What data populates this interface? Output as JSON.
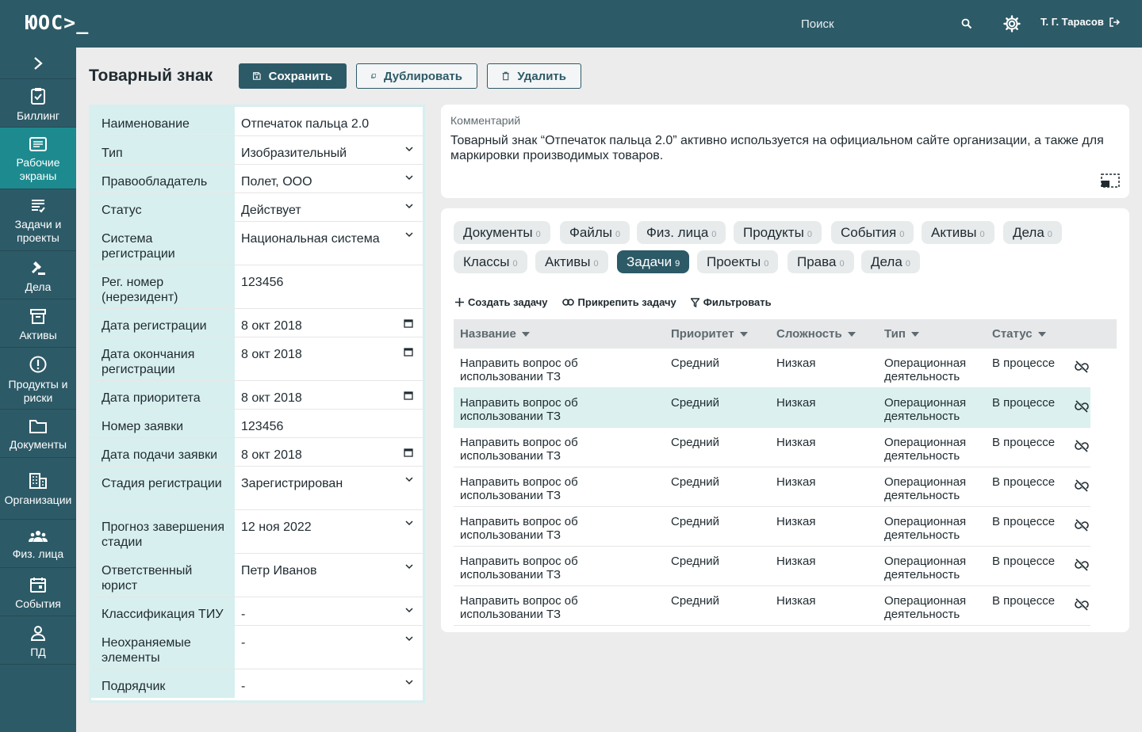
{
  "topbar": {
    "logo": "ЮОС>_",
    "search_placeholder": "Поиск",
    "user_name": "Т. Г. Тарасов"
  },
  "sidenav": [
    {
      "label": "Биллинг",
      "icon": "clipboard-check-icon",
      "active": false
    },
    {
      "label": "Рабочие экраны",
      "icon": "monitor-list-icon",
      "active": true
    },
    {
      "label": "Задачи и проекты",
      "icon": "tasks-icon",
      "active": false
    },
    {
      "label": "Дела",
      "icon": "gavel-icon",
      "active": false
    },
    {
      "label": "Активы",
      "icon": "archive-icon",
      "active": false
    },
    {
      "label": "Продукты и риски",
      "icon": "alert-circle-icon",
      "active": false
    },
    {
      "label": "Документы",
      "icon": "folder-icon",
      "active": false
    },
    {
      "label": "Организации",
      "icon": "building-icon",
      "active": false
    },
    {
      "label": "Физ. лица",
      "icon": "people-icon",
      "active": false
    },
    {
      "label": "События",
      "icon": "calendar-icon",
      "active": false
    },
    {
      "label": "ПД",
      "icon": "person-icon",
      "active": false
    }
  ],
  "page": {
    "title": "Товарный знак",
    "save_label": "Сохранить",
    "duplicate_label": "Дублировать",
    "delete_label": "Удалить"
  },
  "form": [
    {
      "label": "Наименование",
      "value": "Отпечаток пальца 2.0",
      "control": "text"
    },
    {
      "label": "Тип",
      "value": "Изобразительный",
      "control": "select"
    },
    {
      "label": "Правообладатель",
      "value": "Полет, ООО",
      "control": "select"
    },
    {
      "label": "Статус",
      "value": "Действует",
      "control": "select"
    },
    {
      "label": "Система регистрации",
      "value": "Национальная система",
      "control": "select"
    },
    {
      "label": "Рег. номер (нерезидент)",
      "value": "123456",
      "control": "text"
    },
    {
      "label": "Дата регистрации",
      "value": "8 окт 2018",
      "control": "date"
    },
    {
      "label": "Дата окончания регистрации",
      "value": "8 окт 2018",
      "control": "date"
    },
    {
      "label": "Дата приоритета",
      "value": "8 окт 2018",
      "control": "date"
    },
    {
      "label": "Номер заявки",
      "value": "123456",
      "control": "text"
    },
    {
      "label": "Дата подачи заявки",
      "value": "8 окт 2018",
      "control": "date"
    },
    {
      "label": "Стадия регистрации",
      "value": "Зарегистрирован",
      "control": "select"
    },
    {
      "label": "Прогноз завершения стадии",
      "value": "12 ноя 2022",
      "control": "select"
    },
    {
      "label": "Ответственный юрист",
      "value": "Петр Иванов",
      "control": "select"
    },
    {
      "label": "Классификация ТИУ",
      "value": "-",
      "control": "select"
    },
    {
      "label": "Неохраняемые элементы",
      "value": "-",
      "control": "select"
    },
    {
      "label": "Подрядчик",
      "value": "-",
      "control": "select"
    }
  ],
  "comment": {
    "label": "Комментарий",
    "text": "Товарный знак “Отпечаток пальца 2.0” активно используется на официальном сайте организации, а также для маркировки производимых товаров."
  },
  "tabs": [
    {
      "label": "Документы",
      "count": "0",
      "active": false
    },
    {
      "label": "Файлы",
      "count": "0",
      "active": false
    },
    {
      "label": "Физ. лица",
      "count": "0",
      "active": false
    },
    {
      "label": "Продукты",
      "count": "0",
      "active": false
    },
    {
      "label": "События",
      "count": "0",
      "active": false
    },
    {
      "label": "Активы",
      "count": "0",
      "active": false
    },
    {
      "label": "Дела",
      "count": "0",
      "active": false
    },
    {
      "label": "Классы",
      "count": "0",
      "active": false
    },
    {
      "label": "Активы",
      "count": "0",
      "active": false
    },
    {
      "label": "Задачи",
      "count": "9",
      "active": true
    },
    {
      "label": "Проекты",
      "count": "0",
      "active": false
    },
    {
      "label": "Права",
      "count": "0",
      "active": false
    },
    {
      "label": "Дела",
      "count": "0",
      "active": false
    }
  ],
  "task_actions": {
    "create": "Создать задачу",
    "attach": "Прикрепить задачу",
    "filter": "Фильтровать"
  },
  "table": {
    "headers": [
      "Название",
      "Приоритет",
      "Сложность",
      "Тип",
      "Статус"
    ],
    "rows": [
      {
        "name": "Направить вопрос об использовании ТЗ",
        "priority": "Средний",
        "complexity": "Низкая",
        "type": "Операционная деятельность",
        "status": "В процессе"
      },
      {
        "name": "Направить вопрос об использовании ТЗ",
        "priority": "Средний",
        "complexity": "Низкая",
        "type": "Операционная деятельность",
        "status": "В процессе"
      },
      {
        "name": "Направить вопрос об использовании ТЗ",
        "priority": "Средний",
        "complexity": "Низкая",
        "type": "Операционная деятельность",
        "status": "В процессе"
      },
      {
        "name": "Направить вопрос об использовании ТЗ",
        "priority": "Средний",
        "complexity": "Низкая",
        "type": "Операционная деятельность",
        "status": "В процессе"
      },
      {
        "name": "Направить вопрос об использовании ТЗ",
        "priority": "Средний",
        "complexity": "Низкая",
        "type": "Операционная деятельность",
        "status": "В процессе"
      },
      {
        "name": "Направить вопрос об использовании ТЗ",
        "priority": "Средний",
        "complexity": "Низкая",
        "type": "Операционная деятельность",
        "status": "В процессе"
      },
      {
        "name": "Направить вопрос об использовании ТЗ",
        "priority": "Средний",
        "complexity": "Низкая",
        "type": "Операционная деятельность",
        "status": "В процессе"
      }
    ],
    "highlighted_row": 1
  },
  "colors": {
    "brand": "#2d5a67",
    "active_nav": "#1d8a8f",
    "label_bg": "#d8efef",
    "row_highlight": "#dcf1ef"
  }
}
